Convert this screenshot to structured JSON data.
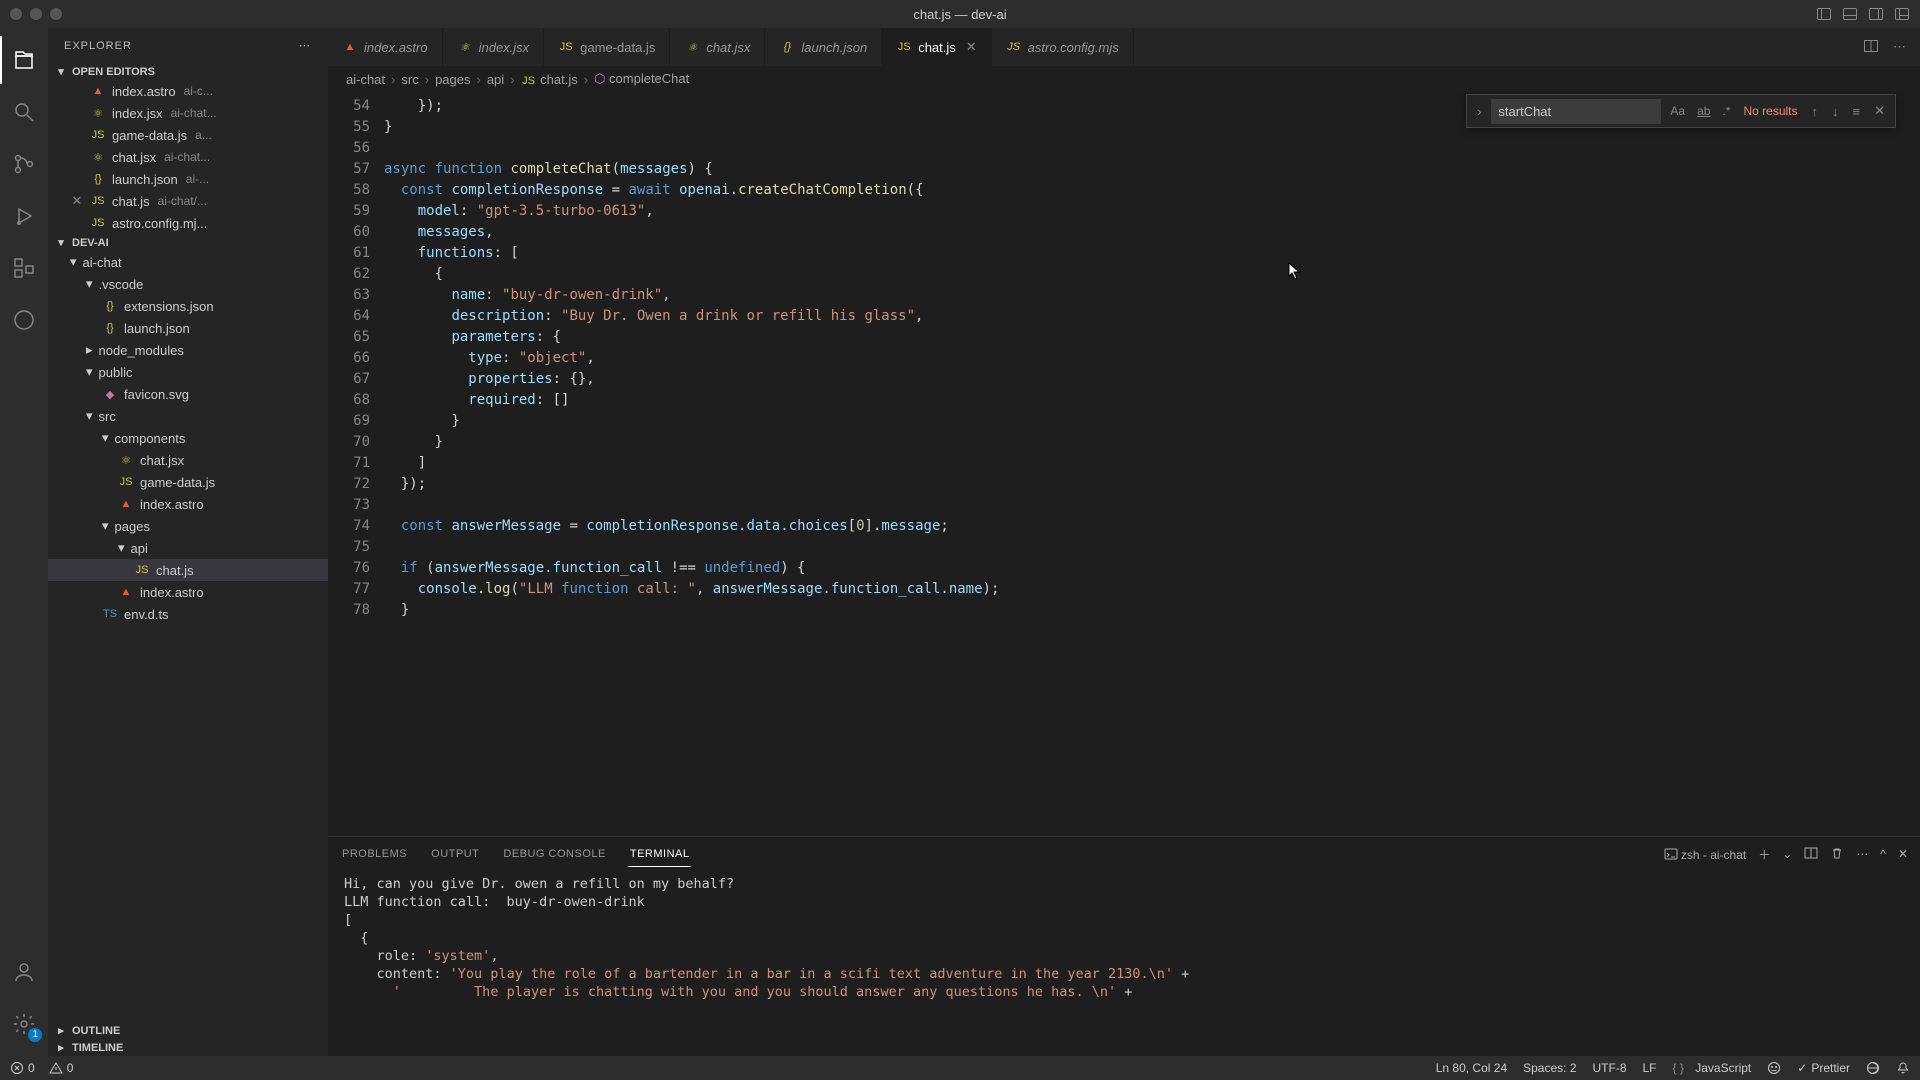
{
  "window": {
    "title": "chat.js — dev-ai"
  },
  "tabs": [
    {
      "icon": "astro",
      "label": "index.astro",
      "italic": true
    },
    {
      "icon": "jsx",
      "label": "index.jsx",
      "italic": true
    },
    {
      "icon": "js",
      "label": "game-data.js"
    },
    {
      "icon": "jsx",
      "label": "chat.jsx",
      "italic": true
    },
    {
      "icon": "json",
      "label": "launch.json",
      "italic": true
    },
    {
      "icon": "js",
      "label": "chat.js",
      "active": true,
      "close": true
    },
    {
      "icon": "js",
      "label": "astro.config.mjs",
      "italic": true
    }
  ],
  "breadcrumbs": [
    "ai-chat",
    "src",
    "pages",
    "api",
    "chat.js",
    "completeChat"
  ],
  "sidebar": {
    "title": "EXPLORER",
    "openEditors": "OPEN EDITORS",
    "devai": "DEV-AI",
    "outline": "OUTLINE",
    "timeline": "TIMELINE",
    "editors": [
      {
        "icon": "astro",
        "name": "index.astro",
        "hint": "ai-c..."
      },
      {
        "icon": "jsx",
        "name": "index.jsx",
        "hint": "ai-chat..."
      },
      {
        "icon": "js",
        "name": "game-data.js",
        "hint": "a..."
      },
      {
        "icon": "jsx",
        "name": "chat.jsx",
        "hint": "ai-chat..."
      },
      {
        "icon": "json",
        "name": "launch.json",
        "hint": "ai-..."
      },
      {
        "icon": "js",
        "name": "chat.js",
        "hint": "ai-chat/...",
        "close": true
      },
      {
        "icon": "js",
        "name": "astro.config.mj...",
        "hint": ""
      }
    ],
    "tree": [
      {
        "d": 1,
        "chev": "▾",
        "name": "ai-chat"
      },
      {
        "d": 2,
        "chev": "▾",
        "name": ".vscode"
      },
      {
        "d": 3,
        "icon": "json",
        "name": "extensions.json"
      },
      {
        "d": 3,
        "icon": "json",
        "name": "launch.json"
      },
      {
        "d": 2,
        "chev": "▸",
        "name": "node_modules"
      },
      {
        "d": 2,
        "chev": "▾",
        "name": "public"
      },
      {
        "d": 3,
        "icon": "svg",
        "name": "favicon.svg"
      },
      {
        "d": 2,
        "chev": "▾",
        "name": "src"
      },
      {
        "d": 3,
        "chev": "▾",
        "name": "components"
      },
      {
        "d": 4,
        "icon": "jsx",
        "name": "chat.jsx"
      },
      {
        "d": 4,
        "icon": "js",
        "name": "game-data.js"
      },
      {
        "d": 4,
        "icon": "astro",
        "name": "index.astro"
      },
      {
        "d": 3,
        "chev": "▾",
        "name": "pages"
      },
      {
        "d": 4,
        "chev": "▾",
        "name": "api"
      },
      {
        "d": 5,
        "icon": "js",
        "name": "chat.js",
        "active": true
      },
      {
        "d": 4,
        "icon": "astro",
        "name": "index.astro"
      },
      {
        "d": 3,
        "icon": "ts",
        "name": "env.d.ts"
      }
    ]
  },
  "find": {
    "value": "startChat",
    "results": "No results",
    "opts": {
      "case": "Aa",
      "word": "ab",
      "regex": ".*"
    }
  },
  "code": {
    "startLine": 54,
    "lines": [
      "    });",
      "}",
      "",
      "async function completeChat(messages) {",
      "  const completionResponse = await openai.createChatCompletion({",
      "    model: \"gpt-3.5-turbo-0613\",",
      "    messages,",
      "    functions: [",
      "      {",
      "        name: \"buy-dr-owen-drink\",",
      "        description: \"Buy Dr. Owen a drink or refill his glass\",",
      "        parameters: {",
      "          type: \"object\",",
      "          properties: {},",
      "          required: []",
      "        }",
      "      }",
      "    ]",
      "  });",
      "",
      "  const answerMessage = completionResponse.data.choices[0].message;",
      "",
      "  if (answerMessage.function_call !== undefined) {",
      "    console.log(\"LLM function call: \", answerMessage.function_call.name);",
      "  }"
    ]
  },
  "panel": {
    "tabs": {
      "problems": "PROBLEMS",
      "output": "OUTPUT",
      "debug": "DEBUG CONSOLE",
      "terminal": "TERMINAL"
    },
    "shell": "zsh - ai-chat",
    "terminal": "Hi, can you give Dr. owen a refill on my behalf?\nLLM function call:  buy-dr-owen-drink\n[\n  {\n    role: 'system',\n    content: 'You play the role of a bartender in a bar in a scifi text adventure in the year 2130.\\n' +\n      '         The player is chatting with you and you should answer any questions he has. \\n' +"
  },
  "status": {
    "errors": "0",
    "warnings": "0",
    "pos": "Ln 80, Col 24",
    "spaces": "Spaces: 2",
    "encoding": "UTF-8",
    "eol": "LF",
    "lang": "JavaScript",
    "prettier": "Prettier"
  }
}
